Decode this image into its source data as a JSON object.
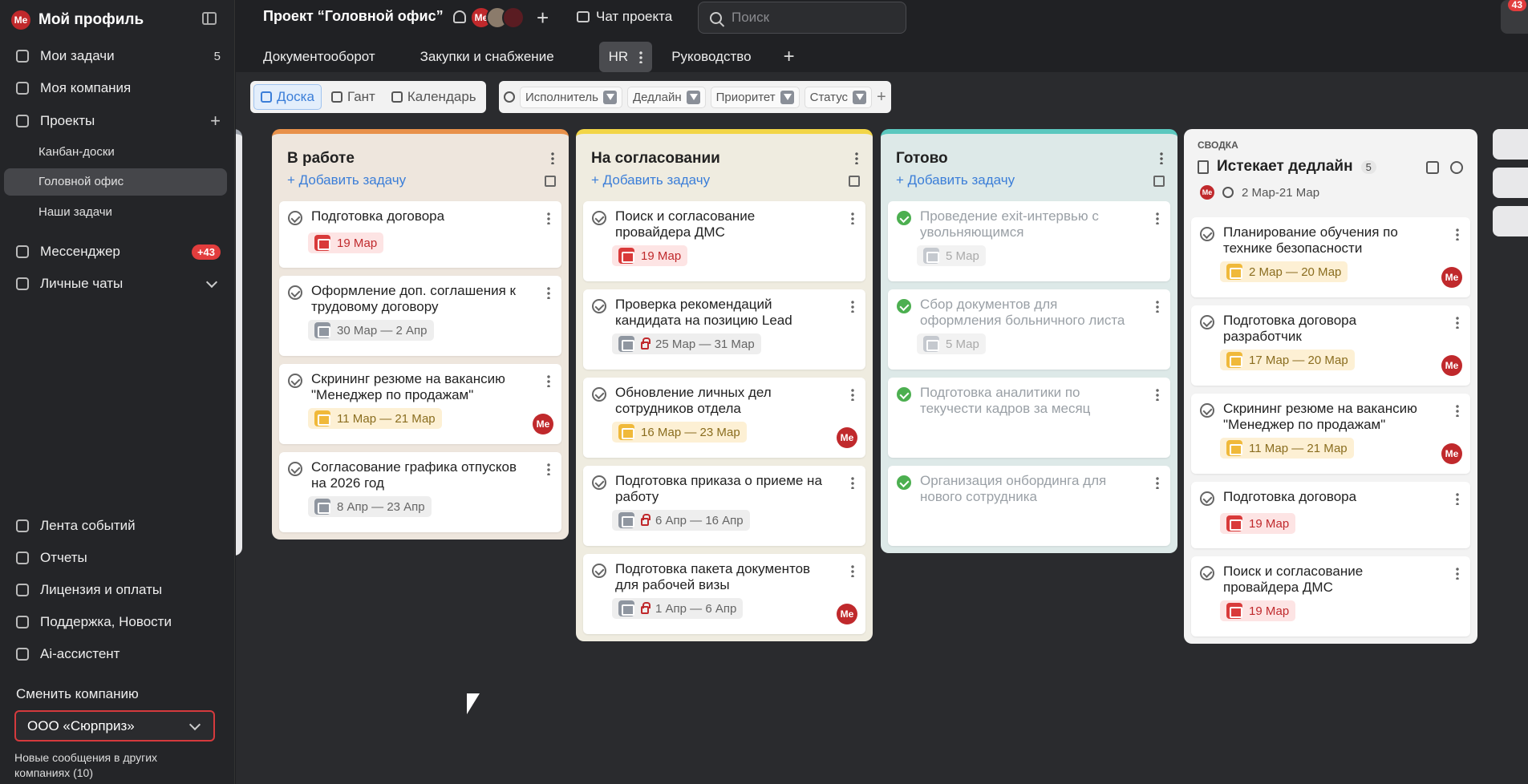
{
  "sidebar": {
    "profile": {
      "avatar": "Ме",
      "name": "Мой профиль"
    },
    "items": [
      {
        "label": "Мои задачи",
        "count": "5",
        "icon": "tasks-icon"
      },
      {
        "label": "Моя компания",
        "icon": "company-icon"
      },
      {
        "label": "Проекты",
        "icon": "projects-icon"
      },
      {
        "label": "Мессенджер",
        "badge": "+43",
        "icon": "messenger-icon"
      },
      {
        "label": "Личные чаты",
        "icon": "chats-icon"
      }
    ],
    "projects": [
      "Канбан-доски",
      "Головной офис",
      "Наши задачи"
    ],
    "bottom": [
      {
        "label": "Лента событий",
        "icon": "feed-icon"
      },
      {
        "label": "Отчеты",
        "icon": "reports-icon"
      },
      {
        "label": "Лицензия и оплаты",
        "icon": "license-icon"
      },
      {
        "label": "Поддержка, Новости",
        "icon": "support-icon"
      },
      {
        "label": "Ai-ассистент",
        "icon": "ai-icon"
      }
    ],
    "switch_label": "Сменить компанию",
    "company": "ООО «Сюрприз»",
    "note": "Новые сообщения в других компаниях (10)"
  },
  "header": {
    "title": "Проект “Головной офис”",
    "avatar_me": "Ме",
    "chat": "Чат проекта",
    "search_placeholder": "Поиск",
    "notif_count": "43",
    "tabs": [
      "Документооборот",
      "Закупки и снабжение",
      "HR",
      "Руководство"
    ]
  },
  "toolbar": {
    "views": [
      "Доска",
      "Гант",
      "Календарь"
    ],
    "filters": [
      "Исполнитель",
      "Дедлайн",
      "Приоритет",
      "Статус"
    ]
  },
  "columns": [
    {
      "title": "В работе",
      "add": "Добавить задачу",
      "color": "#e8914a",
      "bg": "#eee6dd",
      "cards": [
        {
          "title": "Подготовка договора",
          "date": "19 Мар",
          "style": "red"
        },
        {
          "title": "Оформление доп. соглашения к трудовому договору",
          "date": "30 Мар — 2 Апр",
          "style": "gry"
        },
        {
          "title": "Скрининг резюме на вакансию \"Менеджер по продажам\"",
          "date": "11 Мар — 21 Мар",
          "style": "yel",
          "avatar": "Ме"
        },
        {
          "title": "Согласование графика отпусков на 2026 год",
          "date": "8 Апр — 23 Апр",
          "style": "gry"
        }
      ]
    },
    {
      "title": "На согласовании",
      "add": "Добавить задачу",
      "color": "#f2d547",
      "bg": "#efece0",
      "cards": [
        {
          "title": "Поиск и согласование провайдера ДМС",
          "date": "19 Мар",
          "style": "red"
        },
        {
          "title": "Проверка рекомендаций кандидата на позицию Lead",
          "date": "25 Мар — 31 Мар",
          "style": "gry",
          "lock": true
        },
        {
          "title": "Обновление личных дел сотрудников отдела",
          "date": "16 Мар — 23 Мар",
          "style": "yel",
          "avatar": "Ме"
        },
        {
          "title": "Подготовка приказа о приеме на работу",
          "date": "6 Апр — 16 Апр",
          "style": "gry",
          "lock": true
        },
        {
          "title": "Подготовка пакета документов для рабочей визы",
          "date": "1 Апр — 6 Апр",
          "style": "gry",
          "lock": true,
          "avatar": "Ме"
        }
      ]
    },
    {
      "title": "Готово",
      "add": "Добавить задачу",
      "color": "#5bc8bf",
      "bg": "#dde9e8",
      "cards": [
        {
          "title": "Проведение exit-интервью с увольняющимся",
          "date": "5 Мар",
          "style": "dis",
          "done": true
        },
        {
          "title": "Сбор документов для оформления больничного листа",
          "date": "5 Мар",
          "style": "dis",
          "done": true
        },
        {
          "title": "Подготовка аналитики по текучести кадров за месяц",
          "done": true
        },
        {
          "title": "Организация онбординга для нового сотрудника",
          "done": true
        }
      ]
    }
  ],
  "summary": {
    "label": "СВОДКА",
    "title": "Истекает дедлайн",
    "count": "5",
    "range": "2 Мар-21 Мар",
    "cards": [
      {
        "title": "Планирование обучения по технике безопасности",
        "date": "2 Мар — 20 Мар",
        "style": "yel",
        "avatar": "Ме"
      },
      {
        "title": "Подготовка договора разработчик",
        "date": "17 Мар — 20 Мар",
        "style": "yel",
        "avatar": "Ме"
      },
      {
        "title": "Скрининг резюме на вакансию \"Менеджер по продажам\"",
        "date": "11 Мар — 21 Мар",
        "style": "yel",
        "avatar": "Ме"
      },
      {
        "title": "Подготовка договора",
        "date": "19 Мар",
        "style": "red"
      },
      {
        "title": "Поиск и согласование провайдера ДМС",
        "date": "19 Мар",
        "style": "red"
      }
    ]
  }
}
